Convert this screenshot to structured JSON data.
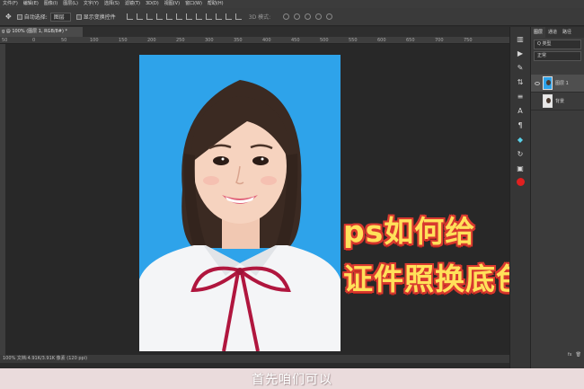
{
  "menu": [
    "文件(F)",
    "编辑(E)",
    "图像(I)",
    "图层(L)",
    "文字(Y)",
    "选择(S)",
    "滤镜(T)",
    "3D(D)",
    "视图(V)",
    "窗口(W)",
    "帮助(H)"
  ],
  "options": {
    "auto_select_label": "自动选择:",
    "auto_select_value": "图层",
    "show_transform_label": "显示变换控件",
    "mode_3d_label": "3D 模式:"
  },
  "document_tab": "g @ 100% (图层 1, RGB/8#) *",
  "ruler_ticks": [
    "50",
    "0",
    "50",
    "100",
    "150",
    "200",
    "250",
    "300",
    "350",
    "400",
    "450",
    "500",
    "550",
    "600",
    "650",
    "700",
    "750"
  ],
  "status_text": "100% 文档:4.91K/3.91K 像素 (120 ppi)",
  "overlay_title": {
    "line1": "ps如何给",
    "line2": "证件照换底色？"
  },
  "panel": {
    "tabs": [
      "图层",
      "通道",
      "路径"
    ],
    "kind_filter": "Q 类型",
    "blend_mode": "正常",
    "layers": [
      {
        "name": "图层 1",
        "selected": true
      },
      {
        "name": "背景",
        "selected": false
      }
    ],
    "fx_label": "fx"
  },
  "subtitle": "首先咱们可以",
  "colors": {
    "photo_background": "#2ea3ea",
    "overlay_fill": "#ffe15a",
    "overlay_outline": "#d8392f",
    "subtitle_bar": "#eadbdc"
  }
}
